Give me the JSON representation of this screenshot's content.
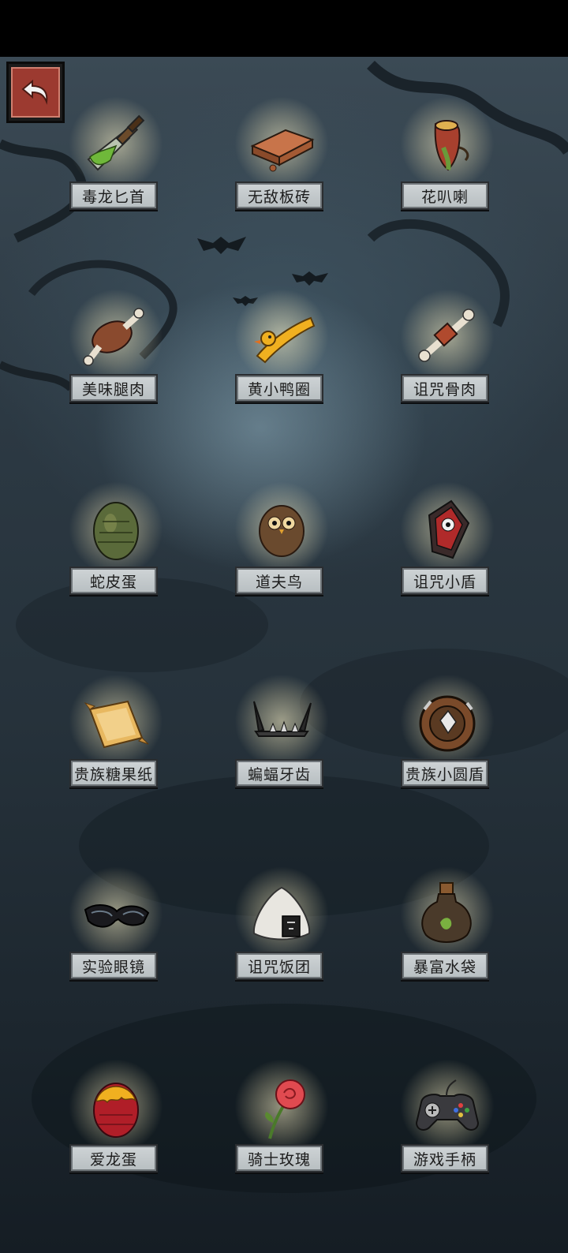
{
  "items": [
    {
      "label": "毒龙匕首",
      "icon": "poison-dagger-icon"
    },
    {
      "label": "无敌板砖",
      "icon": "brick-icon"
    },
    {
      "label": "花叭喇",
      "icon": "pitcher-plant-icon"
    },
    {
      "label": "美味腿肉",
      "icon": "meat-leg-icon"
    },
    {
      "label": "黄小鸭圈",
      "icon": "duck-ring-icon"
    },
    {
      "label": "诅咒骨肉",
      "icon": "cursed-bone-meat-icon"
    },
    {
      "label": "蛇皮蛋",
      "icon": "snakeskin-egg-icon"
    },
    {
      "label": "道夫鸟",
      "icon": "owl-bird-icon"
    },
    {
      "label": "诅咒小盾",
      "icon": "cursed-shield-icon"
    },
    {
      "label": "贵族糖果纸",
      "icon": "candy-wrapper-icon"
    },
    {
      "label": "蝙蝠牙齿",
      "icon": "bat-teeth-icon"
    },
    {
      "label": "贵族小圆盾",
      "icon": "round-shield-icon"
    },
    {
      "label": "实验眼镜",
      "icon": "goggles-icon"
    },
    {
      "label": "诅咒饭团",
      "icon": "rice-ball-icon"
    },
    {
      "label": "暴富水袋",
      "icon": "potion-flask-icon"
    },
    {
      "label": "爱龙蛋",
      "icon": "red-dragon-egg-icon"
    },
    {
      "label": "骑士玫瑰",
      "icon": "rose-icon"
    },
    {
      "label": "游戏手柄",
      "icon": "gamepad-icon"
    }
  ],
  "colors": {
    "label_bg": "#c4cacc",
    "back_button": "#9c3a30",
    "background": "#2c3943"
  },
  "back_icon": "back-arrow-icon"
}
